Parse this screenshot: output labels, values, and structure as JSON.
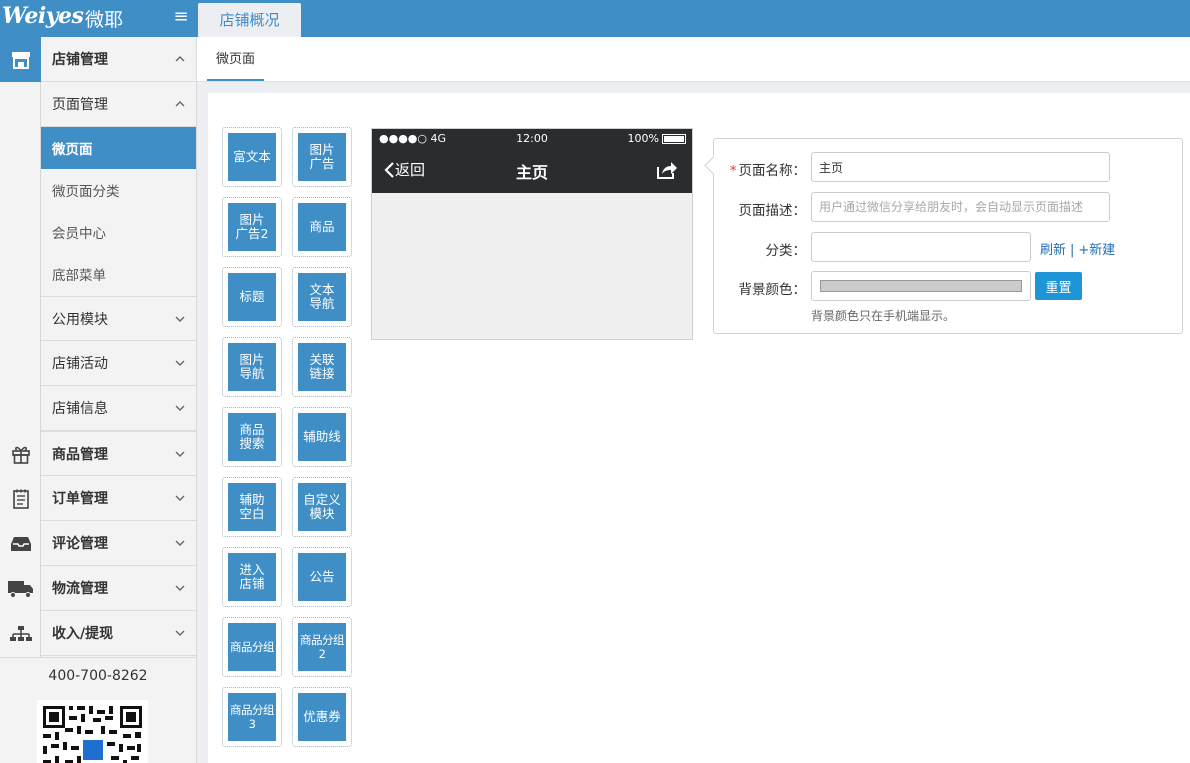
{
  "brand": {
    "logo_text": "Weiyes",
    "logo_cn": "微耶"
  },
  "top_tab": "店铺概况",
  "sidebar": {
    "store_mgmt": "店铺管理",
    "page_mgmt": "页面管理",
    "sub_items": [
      "微页面",
      "微页面分类",
      "会员中心",
      "底部菜单"
    ],
    "group_items": [
      "公用模块",
      "店铺活动",
      "店铺信息"
    ],
    "main_items": [
      "商品管理",
      "订单管理",
      "评论管理",
      "物流管理",
      "收入/提现"
    ],
    "phone": "400-700-8262"
  },
  "sub_tab": "微页面",
  "widgets": [
    "富文本",
    "图片广告",
    "图片广告2",
    "商品",
    "标题",
    "文本导航",
    "图片导航",
    "关联链接",
    "商品搜索",
    "辅助线",
    "辅助空白",
    "自定义模块",
    "进入店铺",
    "公告",
    "商品分组",
    "商品分组2",
    "商品分组3",
    "优惠券"
  ],
  "preview": {
    "signal": "●●●●○ 4G",
    "time": "12:00",
    "battery": "100%",
    "back": "返回",
    "title": "主页"
  },
  "form": {
    "name_label": "页面名称：",
    "name_value": "主页",
    "desc_label": "页面描述：",
    "desc_placeholder": "用户通过微信分享给朋友时，会自动显示页面描述",
    "category_label": "分类：",
    "refresh": "刷新",
    "new": "+新建",
    "bg_label": "背景颜色：",
    "reset": "重置",
    "hint": "背景颜色只在手机端显示。",
    "bg_color": "#cbcbcb"
  },
  "colors": {
    "primary": "#3f8ec6",
    "reset_button": "#1e95d6",
    "required": "#ee3333"
  }
}
